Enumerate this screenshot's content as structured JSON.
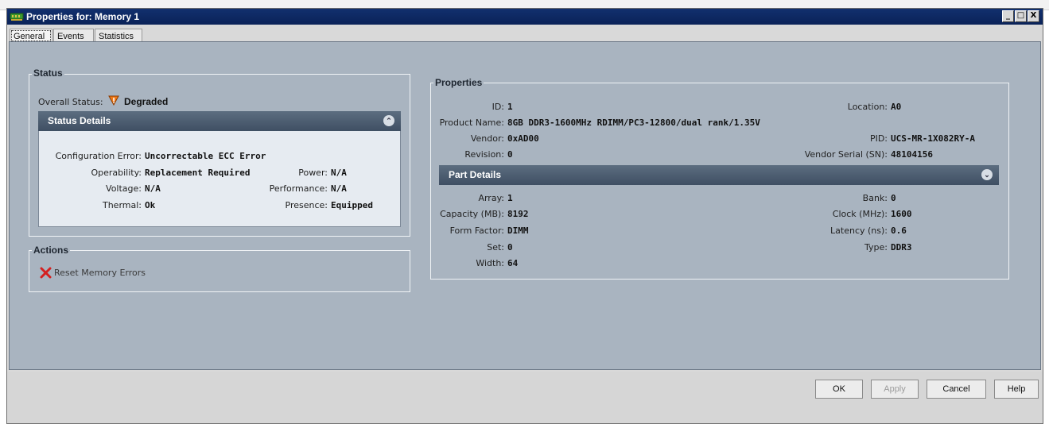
{
  "window": {
    "title": "Properties for: Memory 1",
    "controls": [
      "_",
      "□",
      "X"
    ]
  },
  "tabs": [
    "General",
    "Events",
    "Statistics"
  ],
  "status": {
    "group_title": "Status",
    "overall_label": "Overall Status:",
    "overall_value": "Degraded",
    "overall_icon": "warning-triangle-icon",
    "details_title": "Status Details",
    "config_error_label": "Configuration Error:",
    "config_error_value": "Uncorrectable ECC Error",
    "operability_label": "Operability:",
    "operability_value": "Replacement Required",
    "power_label": "Power:",
    "power_value": "N/A",
    "voltage_label": "Voltage:",
    "voltage_value": "N/A",
    "performance_label": "Performance:",
    "performance_value": "N/A",
    "thermal_label": "Thermal:",
    "thermal_value": "Ok",
    "presence_label": "Presence:",
    "presence_value": "Equipped"
  },
  "actions": {
    "group_title": "Actions",
    "reset_label": "Reset Memory Errors",
    "reset_icon": "red-x-icon"
  },
  "properties": {
    "group_title": "Properties",
    "id_label": "ID:",
    "id_value": "1",
    "location_label": "Location:",
    "location_value": "A0",
    "product_label": "Product Name:",
    "product_value": "8GB DDR3-1600MHz RDIMM/PC3-12800/dual rank/1.35V",
    "vendor_label": "Vendor:",
    "vendor_value": "0xAD00",
    "pid_label": "PID:",
    "pid_value": "UCS-MR-1X082RY-A",
    "revision_label": "Revision:",
    "revision_value": "0",
    "serial_label": "Vendor Serial (SN):",
    "serial_value": "48104156"
  },
  "part_details": {
    "title": "Part Details",
    "array_label": "Array:",
    "array_value": "1",
    "bank_label": "Bank:",
    "bank_value": "0",
    "capacity_label": "Capacity (MB):",
    "capacity_value": "8192",
    "clock_label": "Clock (MHz):",
    "clock_value": "1600",
    "form_label": "Form Factor:",
    "form_value": "DIMM",
    "latency_label": "Latency (ns):",
    "latency_value": "0.6",
    "set_label": "Set:",
    "set_value": "0",
    "type_label": "Type:",
    "type_value": "DDR3",
    "width_label": "Width:",
    "width_value": "64"
  },
  "buttons": {
    "ok": "OK",
    "apply": "Apply",
    "cancel": "Cancel",
    "help": "Help"
  },
  "colors": {
    "titlebar": "#0a2258",
    "content_bg": "#a9b4c0",
    "section_bar": "#4a5a6e",
    "warning": "#e06010",
    "error_x": "#d42020"
  }
}
